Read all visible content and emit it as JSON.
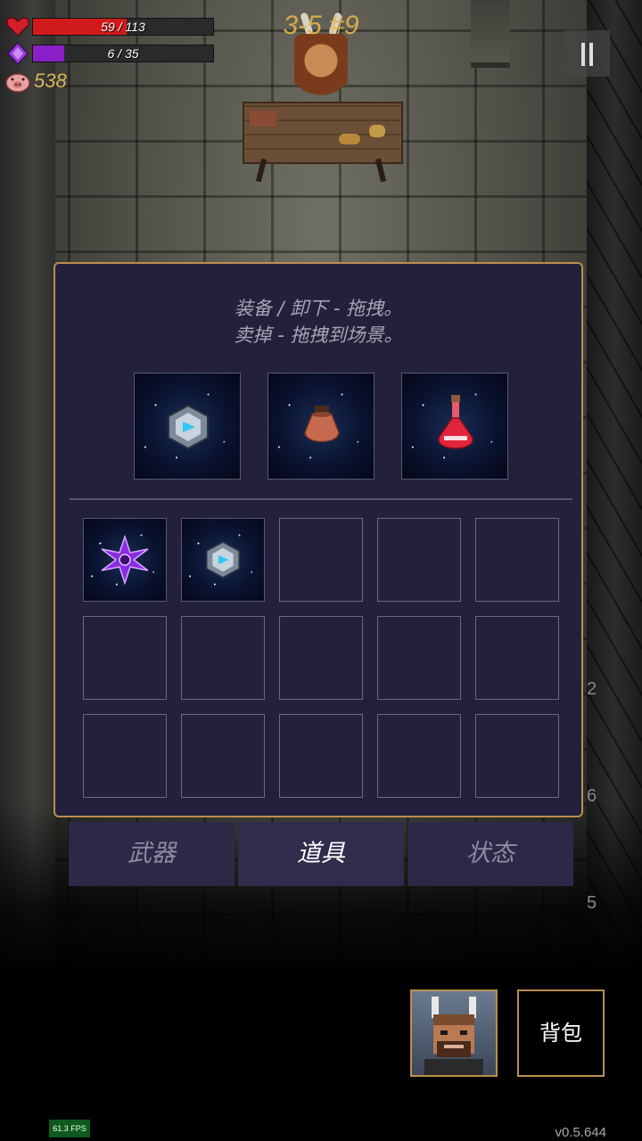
{
  "hud": {
    "hp": {
      "current": 59,
      "max": 113,
      "text": "59 / 113",
      "color": "#d11b1b"
    },
    "mana": {
      "current": 6,
      "max": 35,
      "text": "6 / 35",
      "color": "#8b1fc7"
    },
    "gold": "538",
    "level": "3-5 #9"
  },
  "inventory": {
    "hint_line1": "装备 / 卸下 - 拖拽。",
    "hint_line2": "卖掉 - 拖拽到场景。",
    "equipped": [
      {
        "icon": "gear-cube-icon"
      },
      {
        "icon": "clay-pot-icon"
      },
      {
        "icon": "red-potion-icon"
      }
    ],
    "bag_rows": 3,
    "bag_cols": 5,
    "bag_items": [
      {
        "slot": 0,
        "icon": "purple-shuriken-icon"
      },
      {
        "slot": 1,
        "icon": "gear-cube-icon"
      }
    ]
  },
  "tabs": [
    {
      "label": "武器",
      "active": false
    },
    {
      "label": "道具",
      "active": true
    },
    {
      "label": "状态",
      "active": false
    }
  ],
  "bottom": {
    "bag_button_label": "背包",
    "fps": "61.3 FPS",
    "version": "v0.5.644"
  },
  "side_numbers": [
    "2",
    "6",
    "5"
  ]
}
